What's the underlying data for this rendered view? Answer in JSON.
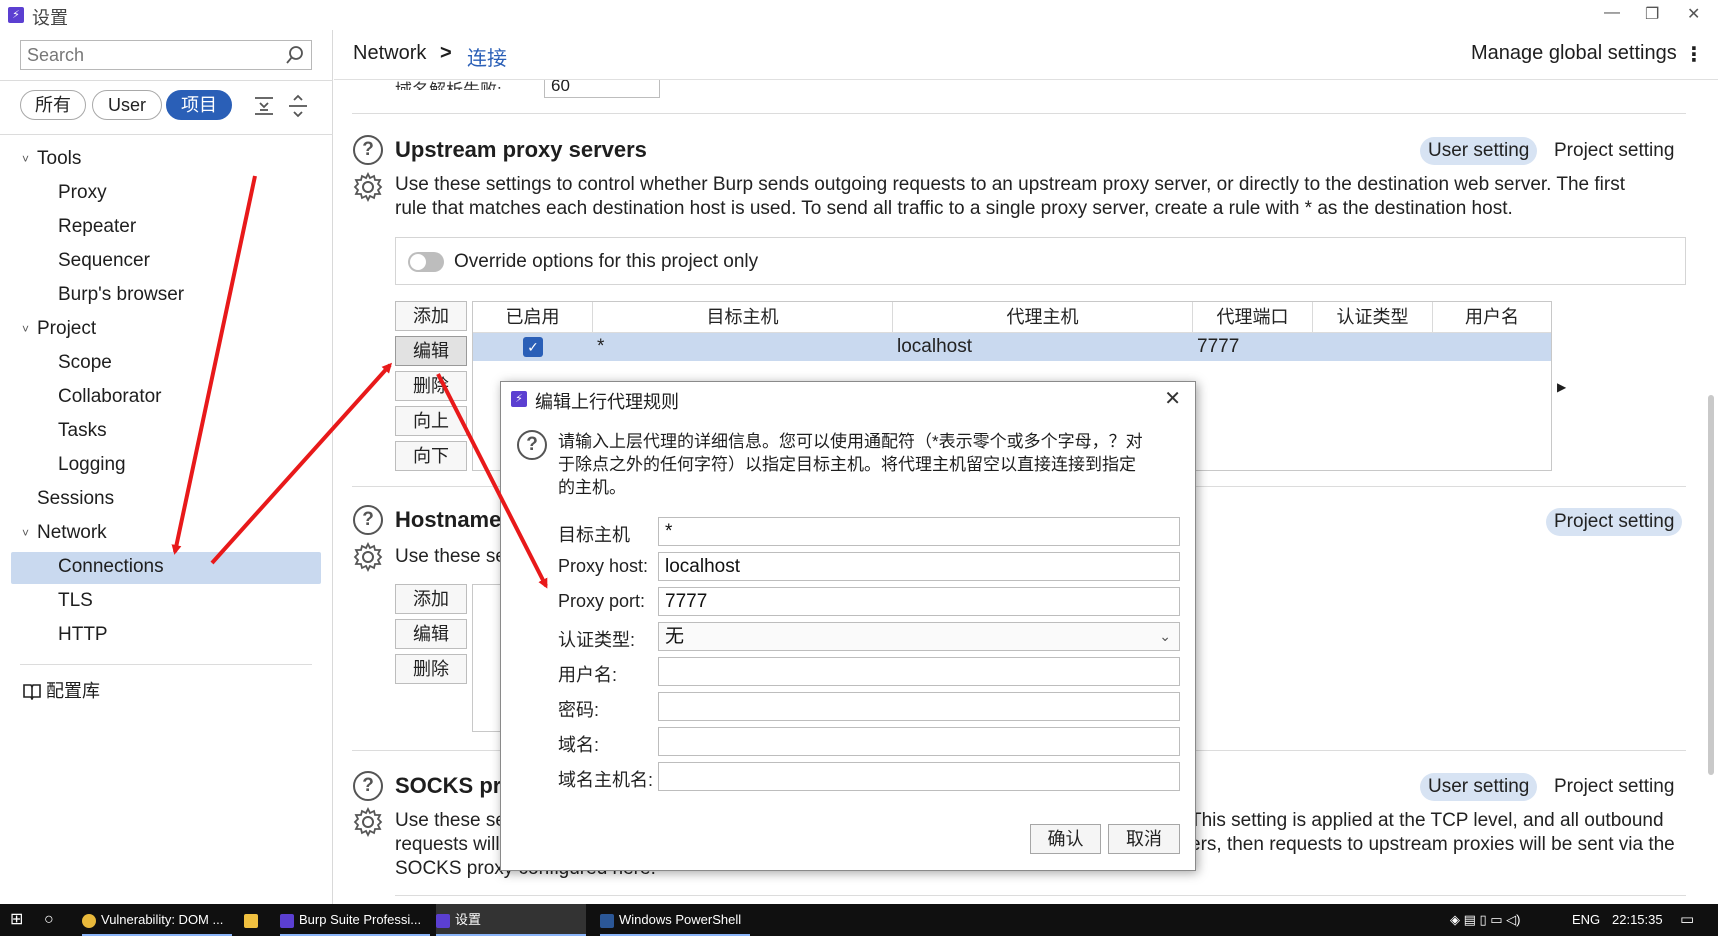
{
  "window": {
    "title": "设置",
    "minimize_icon": "minimize-icon",
    "restore_icon": "restore-icon",
    "close_icon": "close-icon"
  },
  "sidebar": {
    "search_placeholder": "Search",
    "filters": [
      "所有",
      "User",
      "项目"
    ],
    "tree": {
      "tools": "Tools",
      "proxy": "Proxy",
      "repeater": "Repeater",
      "sequencer": "Sequencer",
      "burps_browser": "Burp's browser",
      "project": "Project",
      "scope": "Scope",
      "collaborator": "Collaborator",
      "tasks": "Tasks",
      "logging": "Logging",
      "sessions": "Sessions",
      "network": "Network",
      "connections": "Connections",
      "tls": "TLS",
      "http": "HTTP"
    },
    "config_library": "配置库"
  },
  "breadcrumb": {
    "parent": "Network",
    "separator": ">",
    "current": "连接",
    "manage": "Manage global settings"
  },
  "top_section": {
    "label": "域名解析失败:",
    "value": "60"
  },
  "upstream": {
    "title": "Upstream proxy servers",
    "user_setting": "User setting",
    "project_setting": "Project setting",
    "desc_line1": "Use these settings to  control whether Burp sends outgoing requests to an upstream proxy server, or directly to the destination web server. The first",
    "desc_line2": "rule that matches each destination host is used. To send all traffic to a single proxy server, create a rule with * as the destination host.",
    "override": "Override options for this project only",
    "buttons": {
      "add": "添加",
      "edit": "编辑",
      "remove": "删除",
      "up": "向上",
      "down": "向下"
    },
    "columns": [
      "已启用",
      "目标主机",
      "代理主机",
      "代理端口",
      "认证类型",
      "用户名"
    ],
    "row": {
      "enabled": true,
      "target_host": "*",
      "proxy_host": "localhost",
      "proxy_port": "7777",
      "auth_type": "",
      "username": ""
    }
  },
  "hostname": {
    "title": "Hostname",
    "project_setting": "Project setting",
    "desc": "Use these se",
    "buttons": {
      "add": "添加",
      "edit": "编辑",
      "remove": "删除"
    }
  },
  "socks": {
    "title": "SOCKS pr",
    "user_setting": "User setting",
    "project_setting": "Project setting",
    "desc_left1": "Use these se",
    "desc_left2": "requests will",
    "desc_left3": "SOCKS proxy configured here.",
    "desc_right1": "This setting is applied at the TCP level, and all outbound",
    "desc_right2": "ers, then requests to upstream proxies will be sent via the"
  },
  "dialog": {
    "title": "编辑上行代理规则",
    "info_line1": "请输入上层代理的详细信息。您可以使用通配符（*表示零个或多个字母，？对",
    "info_line2": "于除点之外的任何字符）以指定目标主机。将代理主机留空以直接连接到指定",
    "info_line3": "的主机。",
    "fields": {
      "target_host_label": "目标主机",
      "target_host_value": "*",
      "proxy_host_label": "Proxy host:",
      "proxy_host_value": "localhost",
      "proxy_port_label": "Proxy port:",
      "proxy_port_value": "7777",
      "auth_type_label": "认证类型:",
      "auth_type_value": "无",
      "username_label": "用户名:",
      "username_value": "",
      "password_label": "密码:",
      "password_value": "",
      "domain_label": "域名:",
      "domain_value": "",
      "domain_host_label": "域名主机名:",
      "domain_host_value": ""
    },
    "ok": "确认",
    "cancel": "取消"
  },
  "taskbar": {
    "items": [
      "Vulnerability: DOM ...",
      "Burp Suite Professi...",
      "设置",
      "Windows PowerShell"
    ],
    "lang": "ENG",
    "time": "22:15:35"
  },
  "colors": {
    "accent": "#2a5fb7",
    "selection": "#c9d9ef",
    "arrow": "#e8191a",
    "burp": "#5b3fd1"
  }
}
